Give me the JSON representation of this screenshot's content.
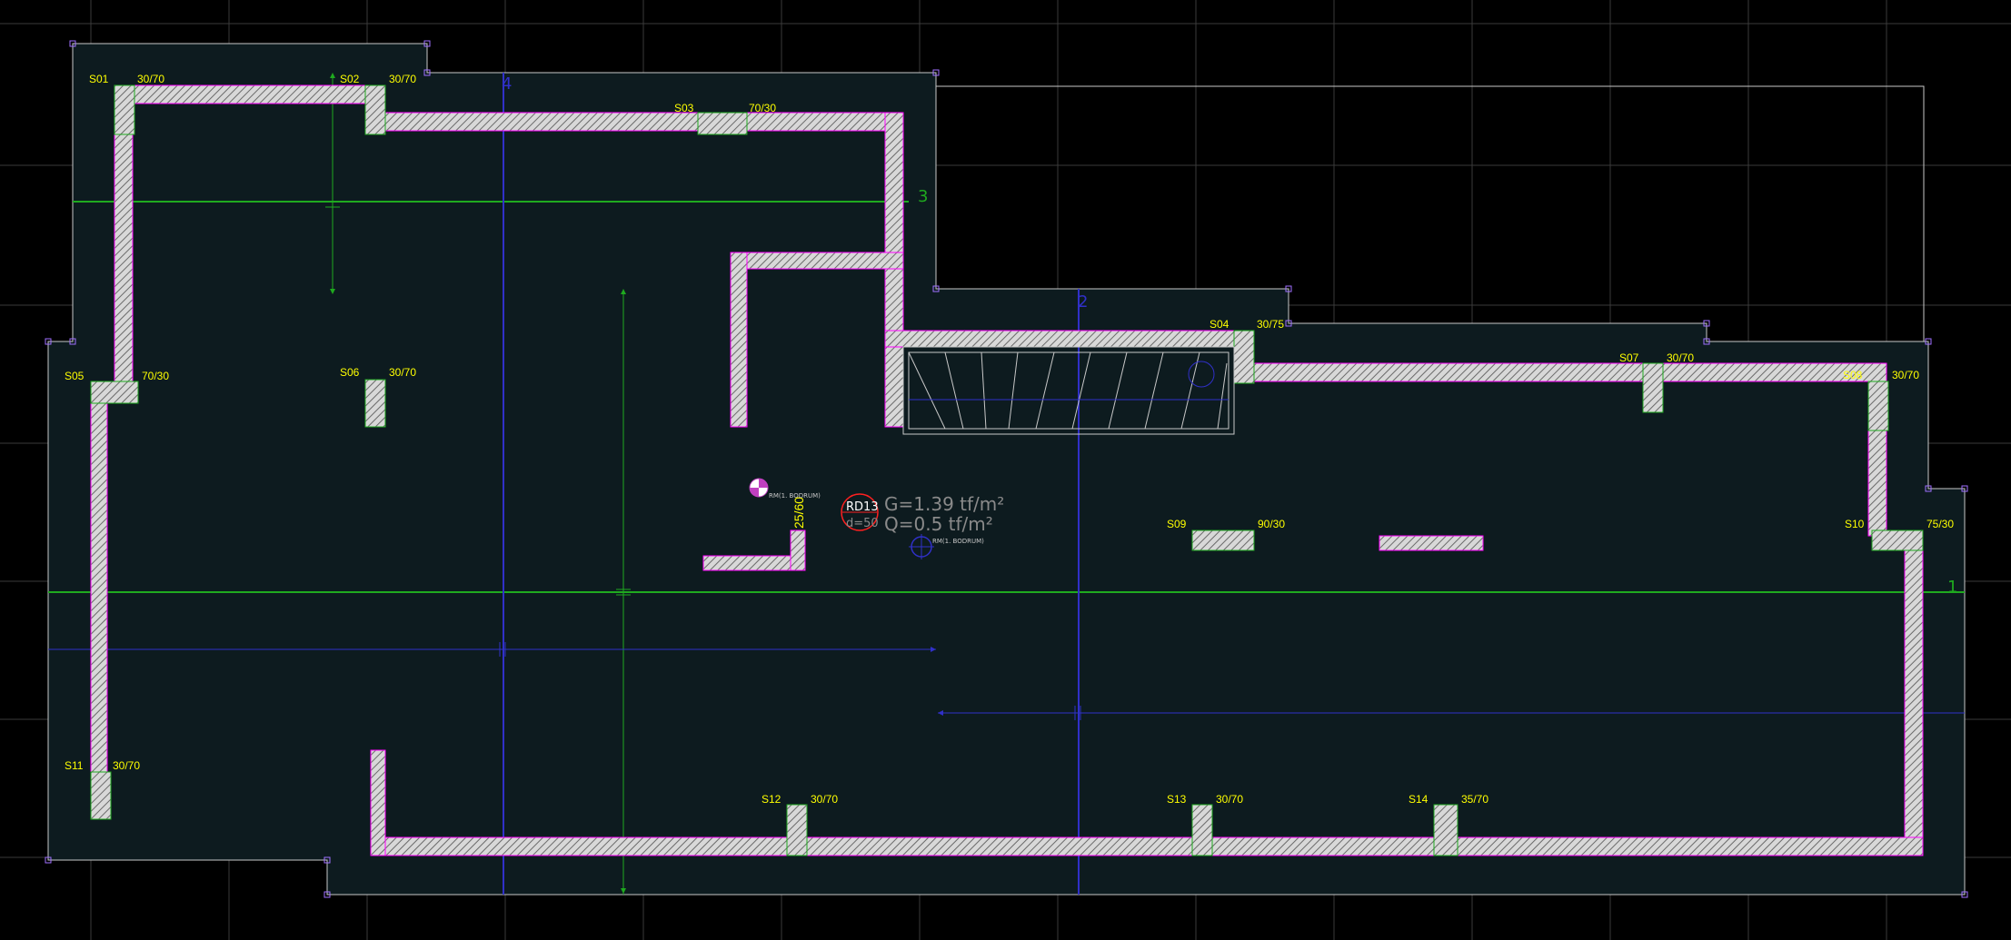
{
  "colors": {
    "background": "#000000",
    "slab": "#0d1b1f",
    "grid": "#3a3a3a",
    "wall_stroke": "#ff00ff",
    "label": "#ffff00",
    "axis_green": "#1faa1f",
    "axis_blue": "#3030c8"
  },
  "axes": [
    {
      "id": "1",
      "label": "1"
    },
    {
      "id": "2",
      "label": "2"
    },
    {
      "id": "3",
      "label": "3"
    },
    {
      "id": "4",
      "label": "4"
    }
  ],
  "columns": [
    {
      "id": "S01",
      "size": "30/70"
    },
    {
      "id": "S02",
      "size": "30/70"
    },
    {
      "id": "S03",
      "size": "70/30"
    },
    {
      "id": "S04",
      "size": "30/75"
    },
    {
      "id": "S05",
      "size": "70/30"
    },
    {
      "id": "S06",
      "size": "30/70"
    },
    {
      "id": "S07",
      "size": "30/70"
    },
    {
      "id": "S08",
      "size": "30/70"
    },
    {
      "id": "S09",
      "size": "90/30"
    },
    {
      "id": "S10",
      "size": "75/30"
    },
    {
      "id": "S11",
      "size": "30/70"
    },
    {
      "id": "S12",
      "size": "30/70"
    },
    {
      "id": "S13",
      "size": "30/70"
    },
    {
      "id": "S14",
      "size": "35/70"
    }
  ],
  "slab": {
    "id": "RD13",
    "thickness": "d=50",
    "G": "G=1.39 tf/m²",
    "Q": "Q=0.5 tf/m²"
  },
  "beam_label": "25/60",
  "markers": {
    "mass_center": "RM(1. BODRUM)",
    "rigidity_center": "RM(1. BODRUM)"
  }
}
